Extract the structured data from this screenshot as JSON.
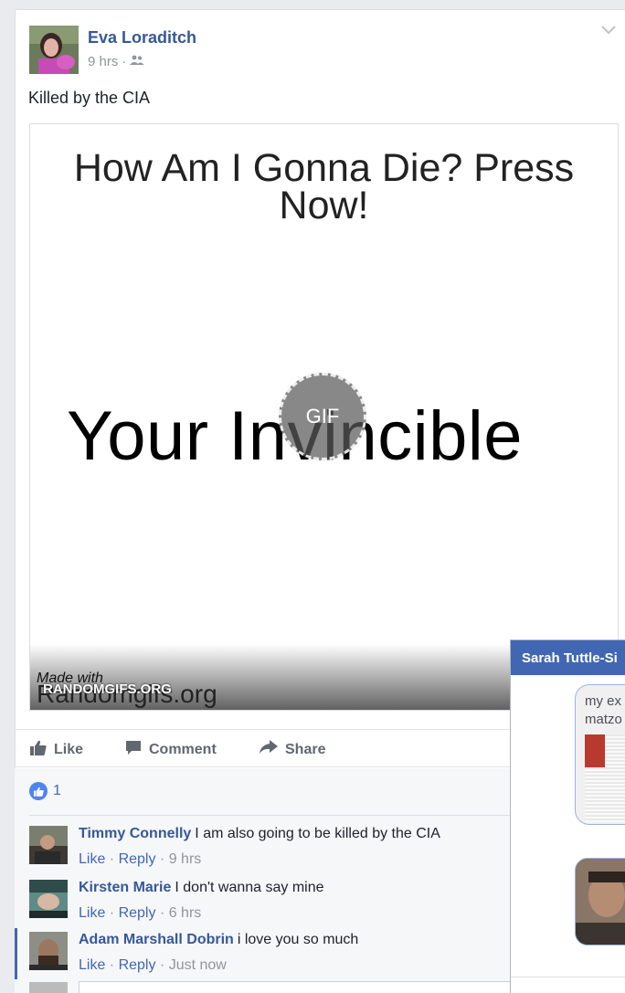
{
  "post": {
    "author": "Eva Loraditch",
    "time": "9 hrs",
    "separator": "·",
    "text": "Killed by the CIA",
    "audience_icon": "friends-icon",
    "menu_icon": "chevron-down-icon"
  },
  "media": {
    "headline": "How Am I Gonna Die? Press Now!",
    "result": "Your Invincible",
    "gif_badge": "GIF",
    "made_with": "Made with",
    "made_site": "Randomgifs.org",
    "watermark": "RANDOMGIFS.ORG"
  },
  "actions": {
    "like": "Like",
    "comment": "Comment",
    "share": "Share"
  },
  "reactions": {
    "count": "1"
  },
  "comments": [
    {
      "name": "Timmy Connelly",
      "text": "I am also going to be killed by the CIA",
      "like": "Like",
      "reply": "Reply",
      "time": "9 hrs"
    },
    {
      "name": "Kirsten Marie",
      "text": "I don't wanna say mine",
      "like": "Like",
      "reply": "Reply",
      "time": "6 hrs"
    },
    {
      "name": "Adam Marshall Dobrin",
      "text": "i love you so much",
      "like": "Like",
      "reply": "Reply",
      "time": "Just now"
    }
  ],
  "chat": {
    "title": "Sarah Tuttle-Si",
    "message_line1": "my ex",
    "message_line2": "matzo"
  },
  "colors": {
    "brand_blue": "#4267b2",
    "link_blue": "#365899",
    "background": "#e9ebee"
  }
}
